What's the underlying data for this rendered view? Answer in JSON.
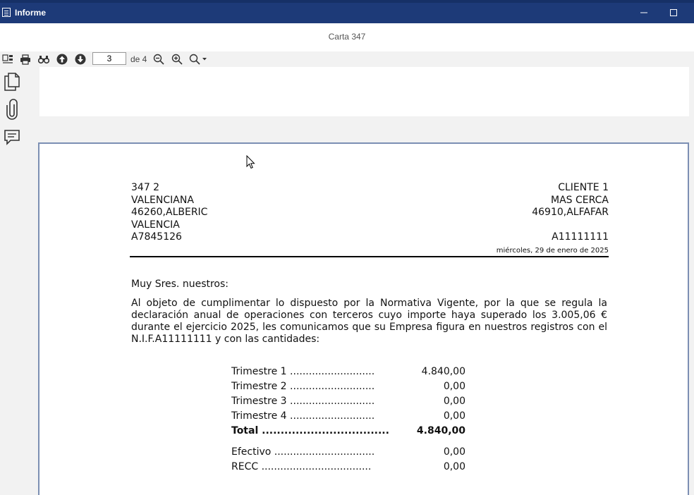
{
  "window": {
    "title": "Informe"
  },
  "report": {
    "subtitle": "Carta 347"
  },
  "toolbar": {
    "page_value": "3",
    "page_of": "de 4"
  },
  "letter": {
    "sender": [
      "347 2",
      "VALENCIANA",
      "46260,ALBERIC",
      "VALENCIA",
      "A7845126"
    ],
    "recipient": [
      "CLIENTE 1",
      "MAS CERCA",
      "46910,ALFAFAR",
      "",
      "A11111111"
    ],
    "date": "miércoles, 29 de enero de 2025",
    "greeting": "Muy Sres. nuestros:",
    "body": "Al objeto de cumplimentar lo dispuesto por la Normativa Vigente, por la que se regula la declaración anual de operaciones con terceros cuyo importe haya superado los 3.005,06 € durante el ejercicio 2025, les comunicamos que su Empresa figura en nuestros registros con el N.I.F.A11111111 y con las cantidades:",
    "rows": [
      {
        "label": "Trimestre 1 ...........................",
        "value": "4.840,00"
      },
      {
        "label": "Trimestre 2 ...........................",
        "value": "0,00"
      },
      {
        "label": "Trimestre 3 ...........................",
        "value": "0,00"
      },
      {
        "label": "Trimestre 4 ...........................",
        "value": "0,00"
      },
      {
        "label": "Total ..................................",
        "value": "4.840,00"
      },
      {
        "label": "Efectivo ................................",
        "value": "0,00"
      },
      {
        "label": "RECC ...................................",
        "value": "0,00"
      }
    ]
  },
  "colors": {
    "titlebar": "#1d3a78",
    "page_border": "#7c8fb3"
  }
}
